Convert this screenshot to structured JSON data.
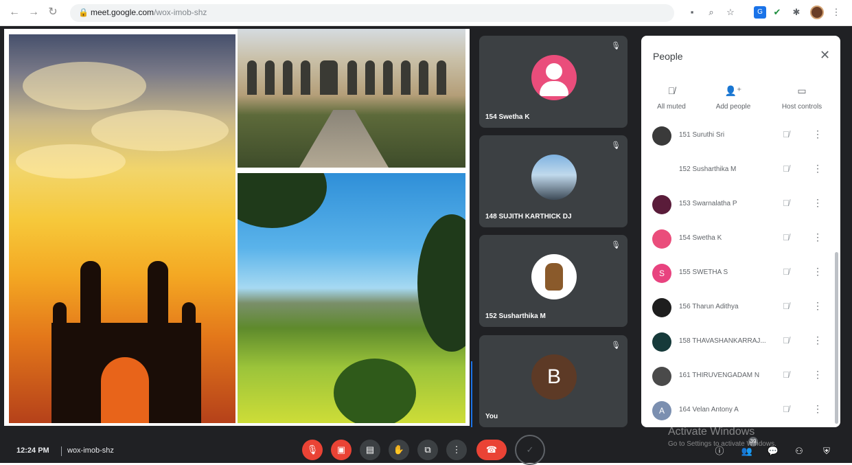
{
  "browser": {
    "url_host": "meet.google.com",
    "url_path": "/wox-imob-shz",
    "icons": [
      "back-icon",
      "forward-icon",
      "reload-icon",
      "lock-icon",
      "camera-icon",
      "zoom-icon",
      "star-icon",
      "extension-icon",
      "check-icon",
      "puzzle-icon",
      "profile-avatar",
      "menu-icon"
    ]
  },
  "tiles": [
    {
      "name": "154 Swetha K",
      "avatar": "person-icon"
    },
    {
      "name": "148 SUJITH KARTHICK DJ",
      "avatar": "photo"
    },
    {
      "name": "152 Susharthika M",
      "avatar": "groot"
    },
    {
      "name": "You",
      "avatar_letter": "B"
    }
  ],
  "people": {
    "title": "People",
    "actions": [
      {
        "label": "All muted",
        "icon": "mic-off-icon"
      },
      {
        "label": "Add people",
        "icon": "add-person-icon"
      },
      {
        "label": "Host controls",
        "icon": "host-controls-icon"
      }
    ],
    "list": [
      {
        "name": "151 Suruthi Sri",
        "color": "#3a3a3a",
        "letter": ""
      },
      {
        "name": "152 Susharthika M",
        "color": "#ffffff",
        "letter": ""
      },
      {
        "name": "153 Swarnalatha P",
        "color": "#5a1c3a",
        "letter": ""
      },
      {
        "name": "154 Swetha K",
        "color": "#ea4d7b",
        "letter": ""
      },
      {
        "name": "155 SWETHA S",
        "color": "#e8437f",
        "letter": "S"
      },
      {
        "name": "156 Tharun Adithya",
        "color": "#1e1e1e",
        "letter": ""
      },
      {
        "name": "158 THAVASHANKARRAJ...",
        "color": "#163a3a",
        "letter": ""
      },
      {
        "name": "161 THIRUVENGADAM N",
        "color": "#4a4a4a",
        "letter": ""
      },
      {
        "name": "164 Velan Antony A",
        "color": "#7b8fb0",
        "letter": "A"
      }
    ]
  },
  "bottom": {
    "time": "12:24 PM",
    "code": "wox-imob-shz",
    "participant_badge": "39",
    "watermark_title": "Activate Windows",
    "watermark_sub": "Go to Settings to activate Windows."
  }
}
